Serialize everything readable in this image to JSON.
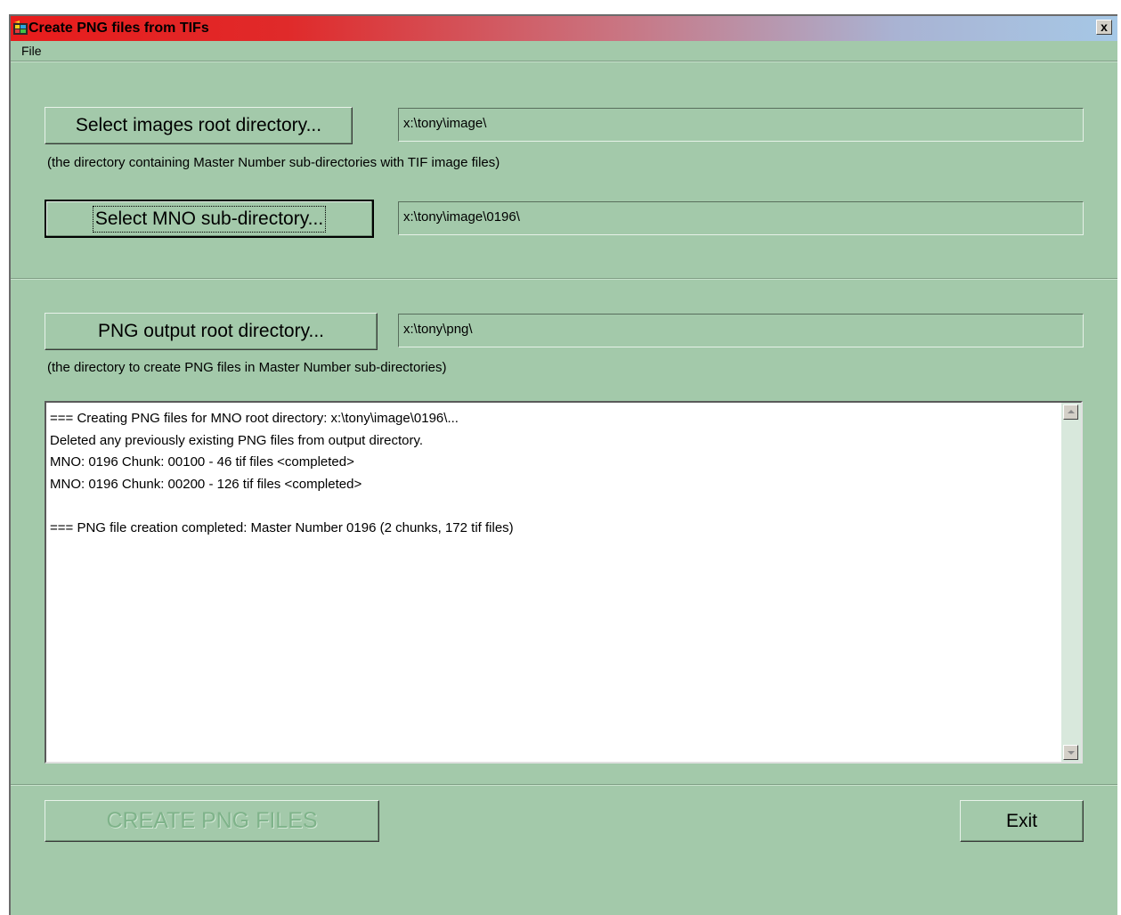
{
  "window": {
    "title": "Create PNG files from TIFs",
    "close_label": "x"
  },
  "menu": {
    "items": [
      {
        "label": "File"
      }
    ]
  },
  "source": {
    "root_button": "Select images root directory...",
    "root_value": "x:\\tony\\image\\",
    "root_hint": "(the directory containing Master Number sub-directories with TIF image files)",
    "mno_button": "Select MNO sub-directory...",
    "mno_value": "x:\\tony\\image\\0196\\"
  },
  "output": {
    "button": "PNG output root directory...",
    "value": "x:\\tony\\png\\",
    "hint": "(the directory to create PNG files in Master Number sub-directories)"
  },
  "log": {
    "lines": [
      "=== Creating PNG files for MNO root directory: x:\\tony\\image\\0196\\...",
      "Deleted any previously existing PNG files from output directory.",
      "MNO: 0196 Chunk: 00100 - 46 tif files <completed>",
      "MNO: 0196 Chunk: 00200 - 126 tif files <completed>",
      "",
      "=== PNG file creation completed: Master Number 0196 (2 chunks, 172 tif files)"
    ]
  },
  "actions": {
    "create_label": "CREATE PNG FILES",
    "exit_label": "Exit"
  }
}
